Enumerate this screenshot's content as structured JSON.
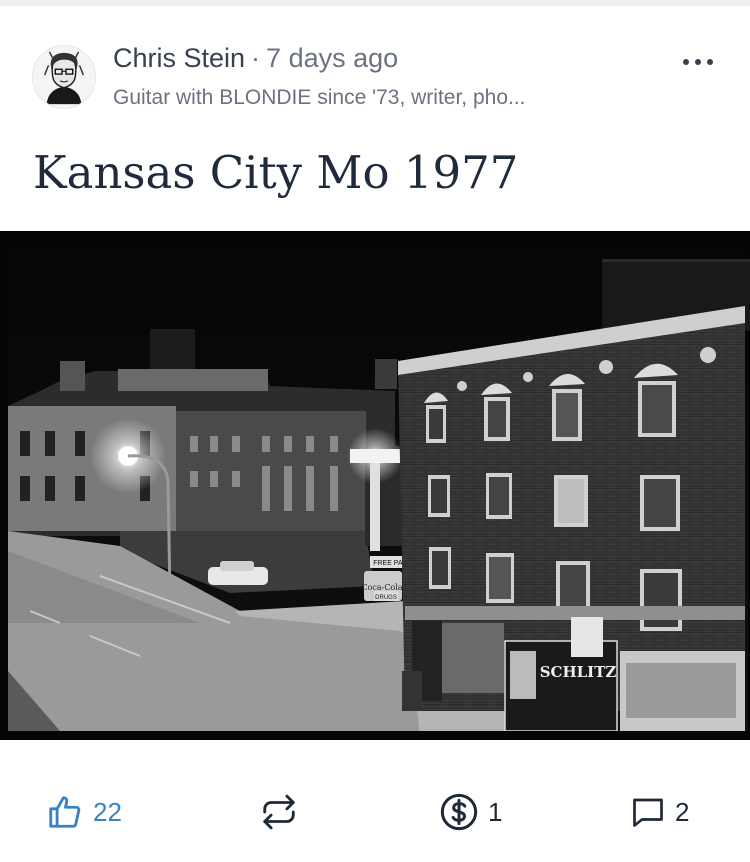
{
  "post": {
    "author_name": "Chris Stein",
    "separator": "·",
    "timestamp": "7 days ago",
    "author_bio": "Guitar with BLONDIE since '73, writer, pho...",
    "title": "Kansas City Mo 1977",
    "photo": {
      "signs": {
        "free_parking": "FREE PARKING",
        "coca_cola": "Coca-Cola",
        "drugs": "DRUGS",
        "schlitz": "SCHLITZ"
      }
    }
  },
  "actions": {
    "like_count": "22",
    "tip_count": "1",
    "comment_count": "2"
  },
  "colors": {
    "accent_blue": "#3b82c4",
    "text_dark": "#1f2a3c",
    "text_muted": "#6b7280"
  },
  "icons": [
    "more-icon",
    "thumbs-up-icon",
    "repost-icon",
    "dollar-icon",
    "comment-icon"
  ]
}
